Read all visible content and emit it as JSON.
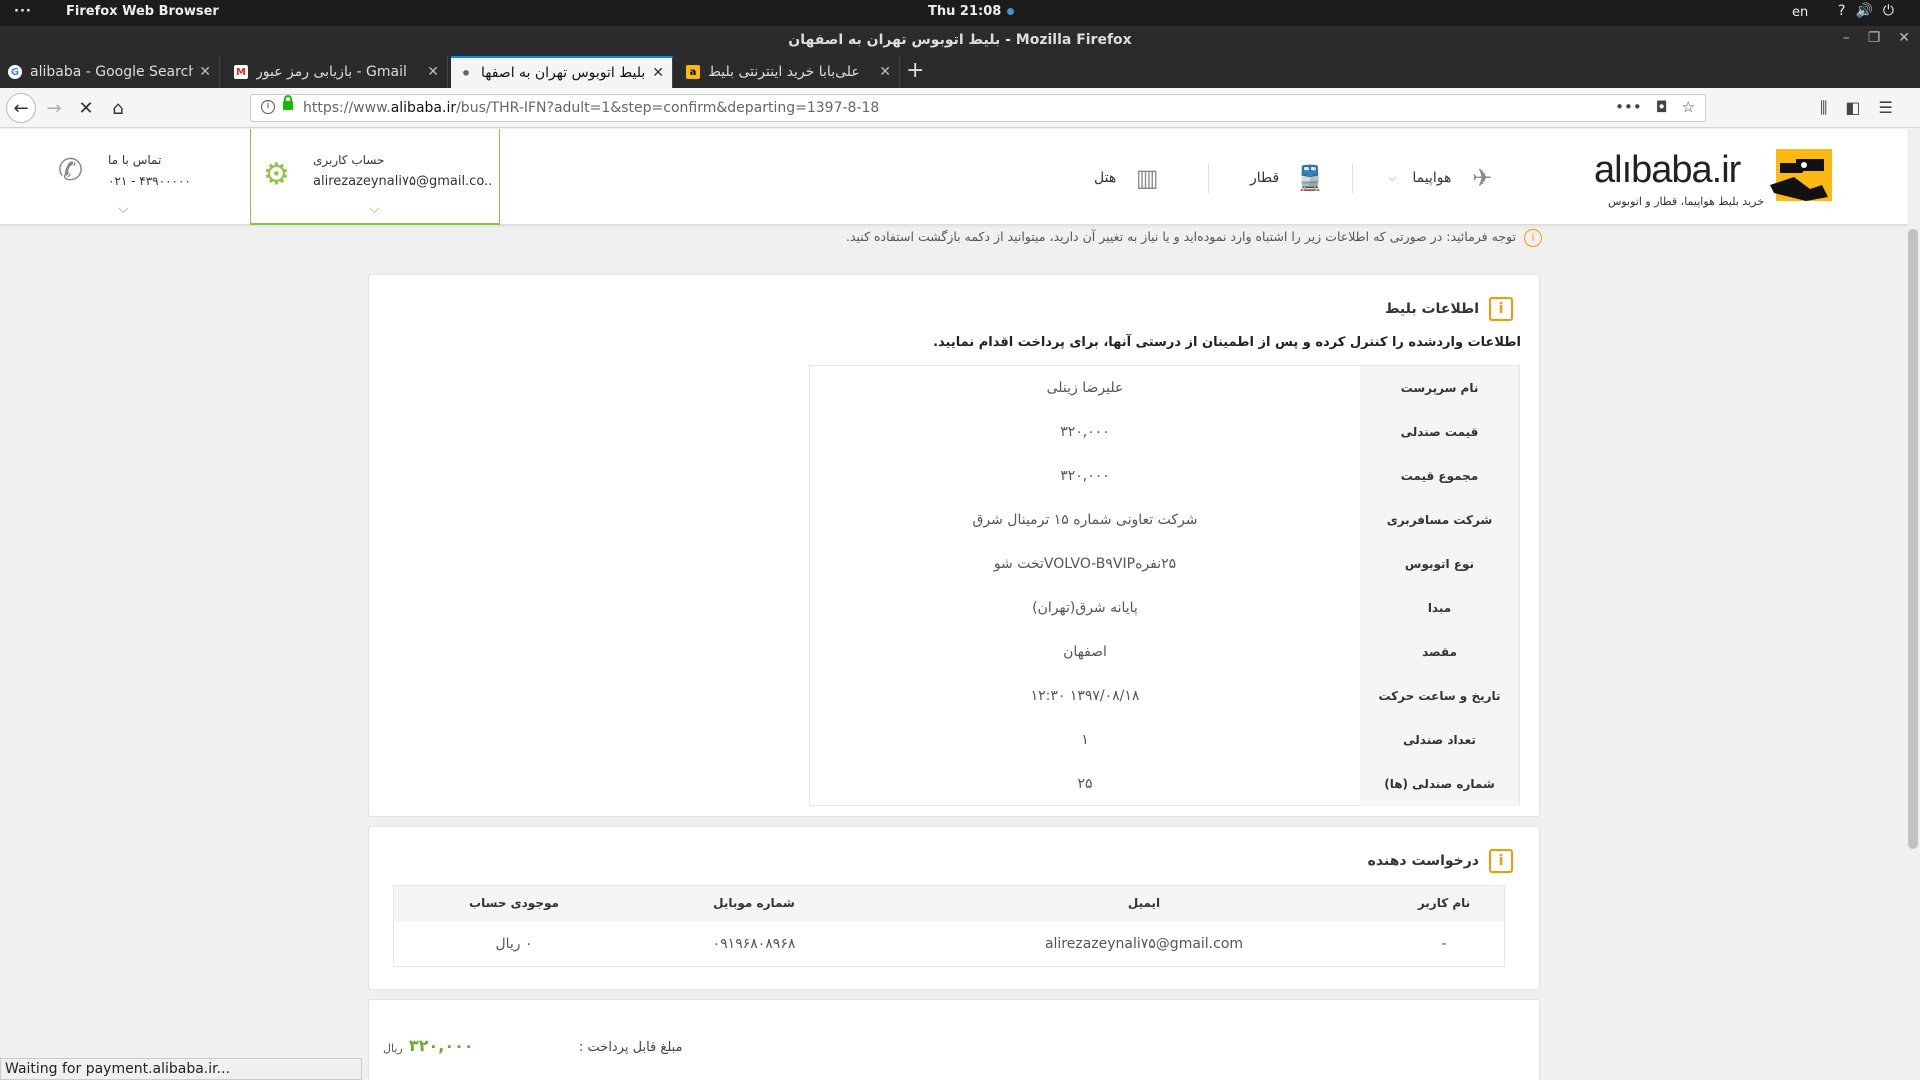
{
  "system": {
    "activities": "···",
    "app_name": "Firefox Web Browser",
    "clock": "Thu 21:08",
    "lang": "en",
    "tray_help": "?"
  },
  "window": {
    "title": "بلیط اتوبوس تهران به اصفهان - Mozilla Firefox"
  },
  "tabs": [
    {
      "label": "alibaba - Google Search",
      "icon": "google-icon",
      "active": false
    },
    {
      "label": "بازیابی رمز عبور - Gmail",
      "icon": "gmail-icon",
      "active": false
    },
    {
      "label": "بلیط اتوبوس تهران به اصفها",
      "icon": "loading-dot",
      "active": true
    },
    {
      "label": "علی‌بابا خرید اینترنتی بلیط",
      "icon": "alibaba-icon",
      "active": false
    }
  ],
  "navbar": {
    "url_prefix": "https://www.",
    "url_domain": "alibaba.ir",
    "url_rest": "/bus/THR-IFN?adult=1&step=confirm&departing=1397-8-18"
  },
  "site_header": {
    "logo_text": "alıbaba.ir",
    "logo_tagline": "خرید بلیط هواپیما، قطار و اتوبوس",
    "nav": {
      "flight": "هواپیما",
      "train": "قطار",
      "hotel": "هتل"
    },
    "account": {
      "label": "حساب کاربری",
      "email": "alirezazeynali۷۵@gmail.co..."
    },
    "contact": {
      "label": "تماس با ما",
      "phone": "۰۲۱ - ۴۳۹۰۰۰۰۰"
    }
  },
  "notice": "توجه فرمائید: در صورتی که اطلاعات زیر را اشتباه وارد نموده‌اید و یا نیاز به تغییر آن دارید، میتوانید از دکمه بازگشت استفاده کنید.",
  "ticket": {
    "title": "اطلاعات بلیط",
    "subtitle": "اطلاعات واردشده را کنترل کرده و پس از اطمینان از درستی آنها، برای پرداخت اقدام نمایید.",
    "rows": [
      {
        "key": "نام سرپرست",
        "value": "علیرضا زینلی"
      },
      {
        "key": "قیمت صندلی",
        "value": "۳۲۰,۰۰۰"
      },
      {
        "key": "مجموع قیمت",
        "value": "۳۲۰,۰۰۰"
      },
      {
        "key": "شرکت مسافربری",
        "value": "شرکت تعاونی شماره ۱۵ ترمینال شرق"
      },
      {
        "key": "نوع اتوبوس",
        "value": "۲۵نفرهVOLVO-B۹VIPتخت شو"
      },
      {
        "key": "مبدا",
        "value": "پایانه شرق(تهران)"
      },
      {
        "key": "مقصد",
        "value": "اصفهان"
      },
      {
        "key": "تاریخ و ساعت حرکت",
        "value": "۱۳۹۷/۰۸/۱۸ ۱۲:۳۰"
      },
      {
        "key": "تعداد صندلی",
        "value": "۱"
      },
      {
        "key": "شماره صندلی (ها)",
        "value": "۲۵"
      }
    ]
  },
  "requester": {
    "title": "درخواست دهنده",
    "headers": {
      "username": "نام کاربر",
      "email": "ایمیل",
      "mobile": "شماره موبایل",
      "balance": "موجودی حساب"
    },
    "row": {
      "username": "-",
      "email": "alirezazeynali۷۵@gmail.com",
      "mobile": "۰۹۱۹۶۸۰۸۹۶۸",
      "balance": "۰ ریال"
    }
  },
  "payment": {
    "label": "مبلغ قابل پرداخت :",
    "amount": "۳۲۰,۰۰۰",
    "currency": "ریال"
  },
  "status_text": "Waiting for payment.alibaba.ir...",
  "colors": {
    "accent_green": "#8cc63f",
    "accent_orange": "#f29b00",
    "tab_highlight": "#0a84ff"
  }
}
